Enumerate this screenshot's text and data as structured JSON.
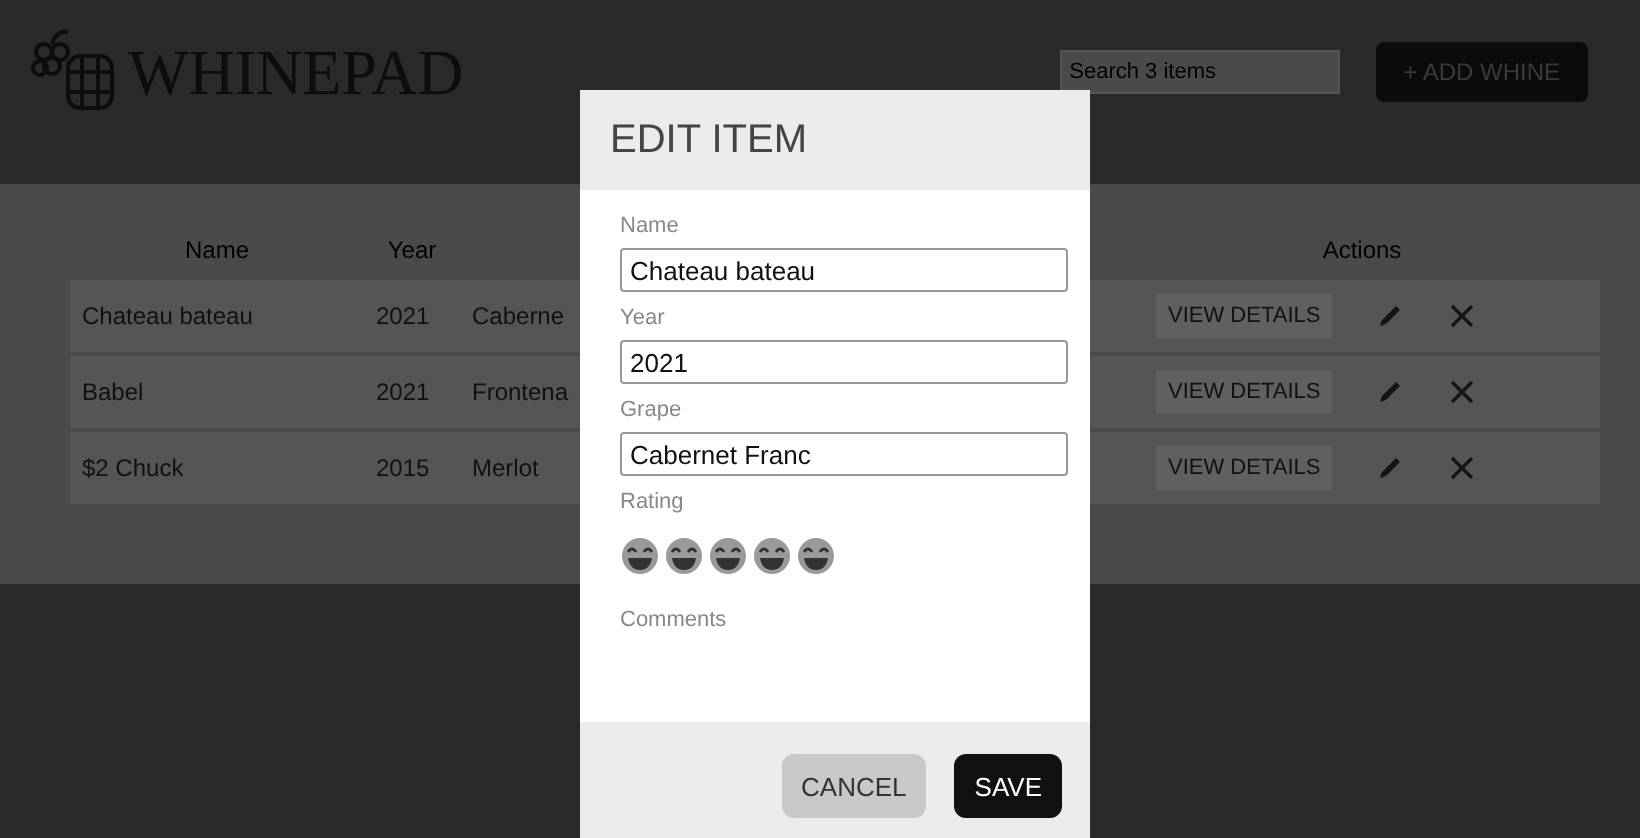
{
  "header": {
    "logo_text": "WHINEPAD",
    "search": {
      "placeholder": "Search 3 items"
    },
    "add_button": "+ ADD WHINE"
  },
  "table": {
    "columns": [
      "Name",
      "Year",
      "Actions"
    ],
    "rows": [
      {
        "name": "Chateau bateau",
        "year": "2021",
        "grape": "Caberne",
        "action": "VIEW DETAILS"
      },
      {
        "name": "Babel",
        "year": "2021",
        "grape": "Frontena",
        "action": "VIEW DETAILS"
      },
      {
        "name": "$2 Chuck",
        "year": "2015",
        "grape": "Merlot",
        "action": "VIEW DETAILS"
      }
    ]
  },
  "modal": {
    "title": "EDIT ITEM",
    "fields": [
      {
        "label": "Name",
        "value": "Chateau bateau"
      },
      {
        "label": "Year",
        "value": "2021"
      },
      {
        "label": "Grape",
        "value": "Cabernet Franc"
      }
    ],
    "rating": {
      "label": "Rating",
      "stars": 5
    },
    "comments_label": "Comments",
    "buttons": [
      {
        "label": "CANCEL",
        "kind": "secondary"
      },
      {
        "label": "SAVE",
        "kind": "primary"
      }
    ]
  }
}
